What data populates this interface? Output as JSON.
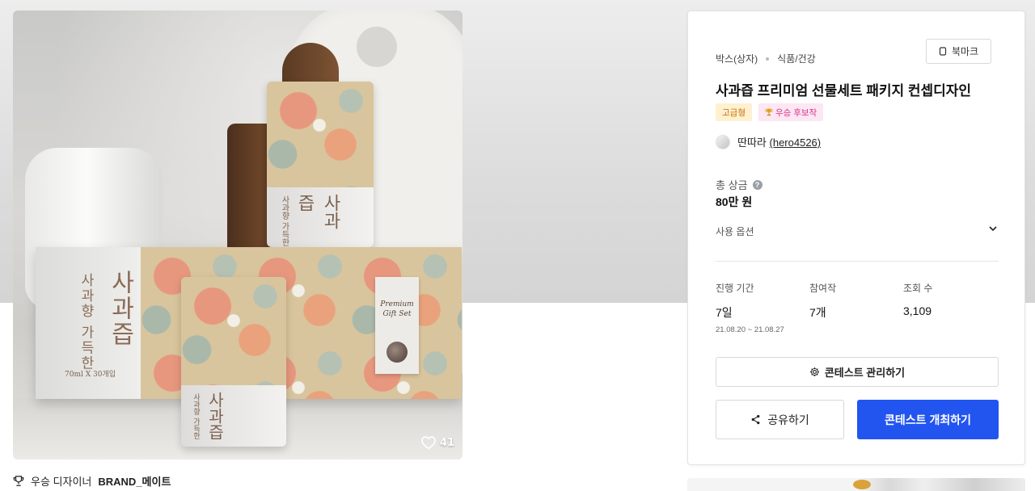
{
  "product_image": {
    "like_count": "41",
    "packaging_text": {
      "main_vertical": "사과즙",
      "sub_vertical": "사과향 가득한",
      "volume": "70ml X 30개입",
      "tag_line": "Premium Gift Set",
      "pouch_label": "사과즙",
      "pouch_sub": "사과향 가득한"
    }
  },
  "designer": {
    "prefix": "우승 디자이너",
    "name": "BRAND_메이트"
  },
  "card": {
    "category_1": "박스(상자)",
    "category_2": "식품/건강",
    "bookmark_label": "북마크",
    "title": "사과즙 프리미엄 선물세트 패키지 컨셉디자인",
    "badge_grade": "고급형",
    "badge_candidate": "우승 후보작",
    "author_name": "딴따라",
    "author_id": "(hero4526)",
    "prize_label": "총 상금",
    "prize_value": "80만 원",
    "options_label": "사용 옵션",
    "stats": {
      "period_label": "진행 기간",
      "period_value": "7일",
      "period_range": "21.08.20 ~ 21.08.27",
      "participants_label": "참여작",
      "participants_value": "7개",
      "views_label": "조회 수",
      "views_value": "3,109"
    },
    "manage_label": "콘테스트 관리하기",
    "share_label": "공유하기",
    "host_label": "콘테스트 개최하기",
    "colors": {
      "primary": "#2255f0",
      "badge_gold_bg": "#fff0cf",
      "badge_gold_text": "#c2700b",
      "badge_pink_bg": "#fde7f3",
      "badge_pink_text": "#d6338a"
    }
  }
}
